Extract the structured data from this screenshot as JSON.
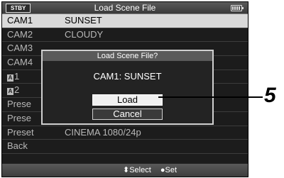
{
  "header": {
    "status": "STBY",
    "title": "Load Scene File",
    "battery_icon": "battery-icon"
  },
  "list": [
    {
      "key": "CAM1",
      "value": "SUNSET",
      "selected": true
    },
    {
      "key": "CAM2",
      "value": "CLOUDY"
    },
    {
      "key": "CAM3",
      "value": ""
    },
    {
      "key": "CAM4",
      "value": ""
    },
    {
      "user_icon": "A",
      "key": "1",
      "value": ""
    },
    {
      "user_icon": "A",
      "key": "2",
      "value": ""
    },
    {
      "key": "Prese",
      "value": ""
    },
    {
      "key": "Prese",
      "value": ""
    },
    {
      "key": "Preset",
      "value": "CINEMA 1080/24p"
    },
    {
      "key": "Back",
      "value": ""
    }
  ],
  "footer": {
    "select_label": "⬍Select",
    "set_label": "●Set"
  },
  "dialog": {
    "title": "Load Scene File?",
    "message": "CAM1: SUNSET",
    "load_label": "Load",
    "cancel_label": "Cancel"
  },
  "callout": {
    "number": "5"
  }
}
